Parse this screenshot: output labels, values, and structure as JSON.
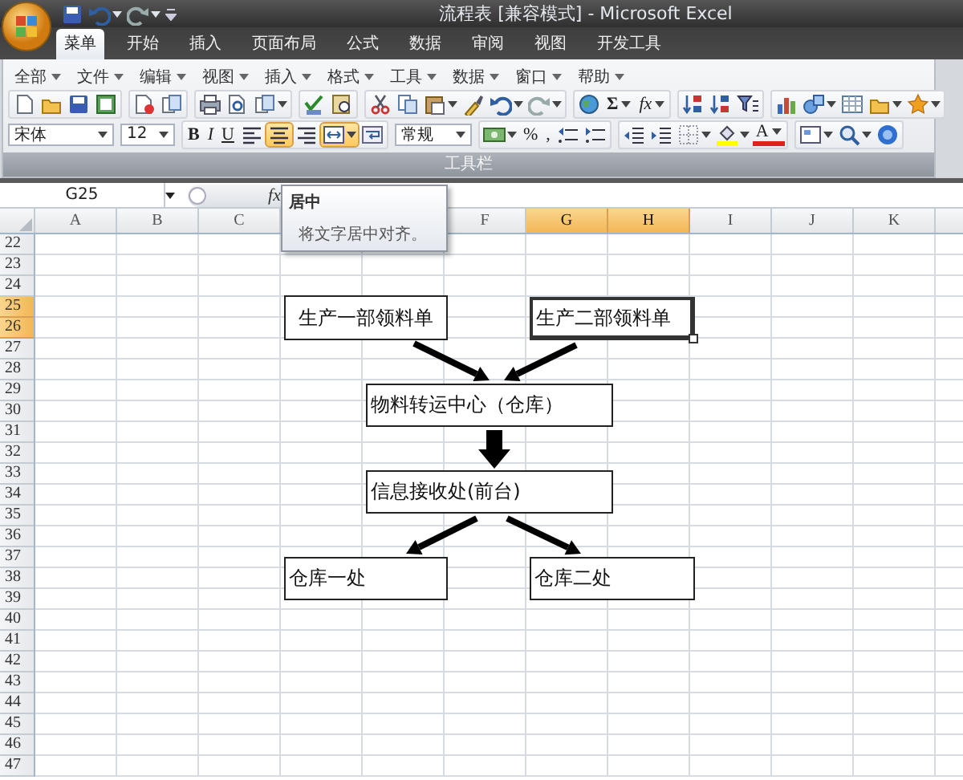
{
  "title_bar": {
    "title": "流程表 [兼容模式] - Microsoft Excel"
  },
  "ribbon_tabs": [
    {
      "label": "菜单",
      "selected": true
    },
    {
      "label": "开始",
      "selected": false
    },
    {
      "label": "插入",
      "selected": false
    },
    {
      "label": "页面布局",
      "selected": false
    },
    {
      "label": "公式",
      "selected": false
    },
    {
      "label": "数据",
      "selected": false
    },
    {
      "label": "审阅",
      "selected": false
    },
    {
      "label": "视图",
      "selected": false
    },
    {
      "label": "开发工具",
      "selected": false
    }
  ],
  "menu_bar": [
    "全部",
    "文件",
    "编辑",
    "视图",
    "插入",
    "格式",
    "工具",
    "数据",
    "窗口",
    "帮助"
  ],
  "toolbar": {
    "font": "宋体",
    "font_size": "12",
    "text_buttons": [
      {
        "kind": "bold",
        "label": "B"
      },
      {
        "kind": "italic",
        "label": "I"
      },
      {
        "kind": "underline",
        "label": "U"
      }
    ],
    "align_buttons": [
      {
        "kind": "left",
        "on": false
      },
      {
        "kind": "center",
        "on": true
      },
      {
        "kind": "right",
        "on": false
      },
      {
        "kind": "merge",
        "on": true
      }
    ],
    "number_format": "常规",
    "number_buttons": [
      "%",
      ","
    ],
    "sum": "Σ",
    "function": "fx",
    "font_color": "A",
    "group_label": "工具栏"
  },
  "formula_bar": {
    "name_box": "G25",
    "function": "fx"
  },
  "tooltip": {
    "title": "居中",
    "text": "将文字居中对齐。"
  },
  "sheet": {
    "columns": [
      {
        "label": "A",
        "selected": false
      },
      {
        "label": "B",
        "selected": false
      },
      {
        "label": "C",
        "selected": false
      },
      {},
      {},
      {
        "label": "F",
        "selected": false
      },
      {
        "label": "G",
        "selected": true
      },
      {
        "label": "H",
        "selected": true
      },
      {
        "label": "I",
        "selected": false
      },
      {
        "label": "J",
        "selected": false
      },
      {
        "label": "K",
        "selected": false
      }
    ],
    "rows": [
      {
        "label": "22",
        "selected": false
      },
      {
        "label": "23",
        "selected": false
      },
      {
        "label": "24",
        "selected": false
      },
      {
        "label": "25",
        "selected": true
      },
      {
        "label": "26",
        "selected": true
      },
      {
        "label": "27",
        "selected": false
      },
      {
        "label": "28",
        "selected": false
      },
      {
        "label": "29",
        "selected": false
      },
      {
        "label": "30",
        "selected": false
      },
      {
        "label": "31",
        "selected": false
      },
      {
        "label": "32",
        "selected": false
      },
      {
        "label": "33",
        "selected": false
      },
      {
        "label": "34",
        "selected": false
      },
      {
        "label": "35",
        "selected": false
      },
      {
        "label": "36",
        "selected": false
      },
      {
        "label": "37",
        "selected": false
      },
      {
        "label": "38",
        "selected": false
      },
      {
        "label": "39",
        "selected": false
      },
      {
        "label": "40",
        "selected": false
      },
      {
        "label": "41",
        "selected": false
      },
      {
        "label": "42",
        "selected": false
      },
      {
        "label": "43",
        "selected": false
      },
      {
        "label": "44",
        "selected": false
      },
      {
        "label": "45",
        "selected": false
      },
      {
        "label": "46",
        "selected": false
      },
      {
        "label": "47",
        "selected": false
      }
    ],
    "shapes": [
      {
        "text": "生产一部领料单",
        "selected": false
      },
      {
        "text": "生产二部领料单",
        "selected": true
      },
      {
        "text": "物料转运中心（仓库）",
        "selected": false
      },
      {
        "text": "信息接收处(前台)",
        "selected": false
      },
      {
        "text": "仓库一处",
        "selected": false
      },
      {
        "text": "仓库二处",
        "selected": false
      }
    ]
  }
}
